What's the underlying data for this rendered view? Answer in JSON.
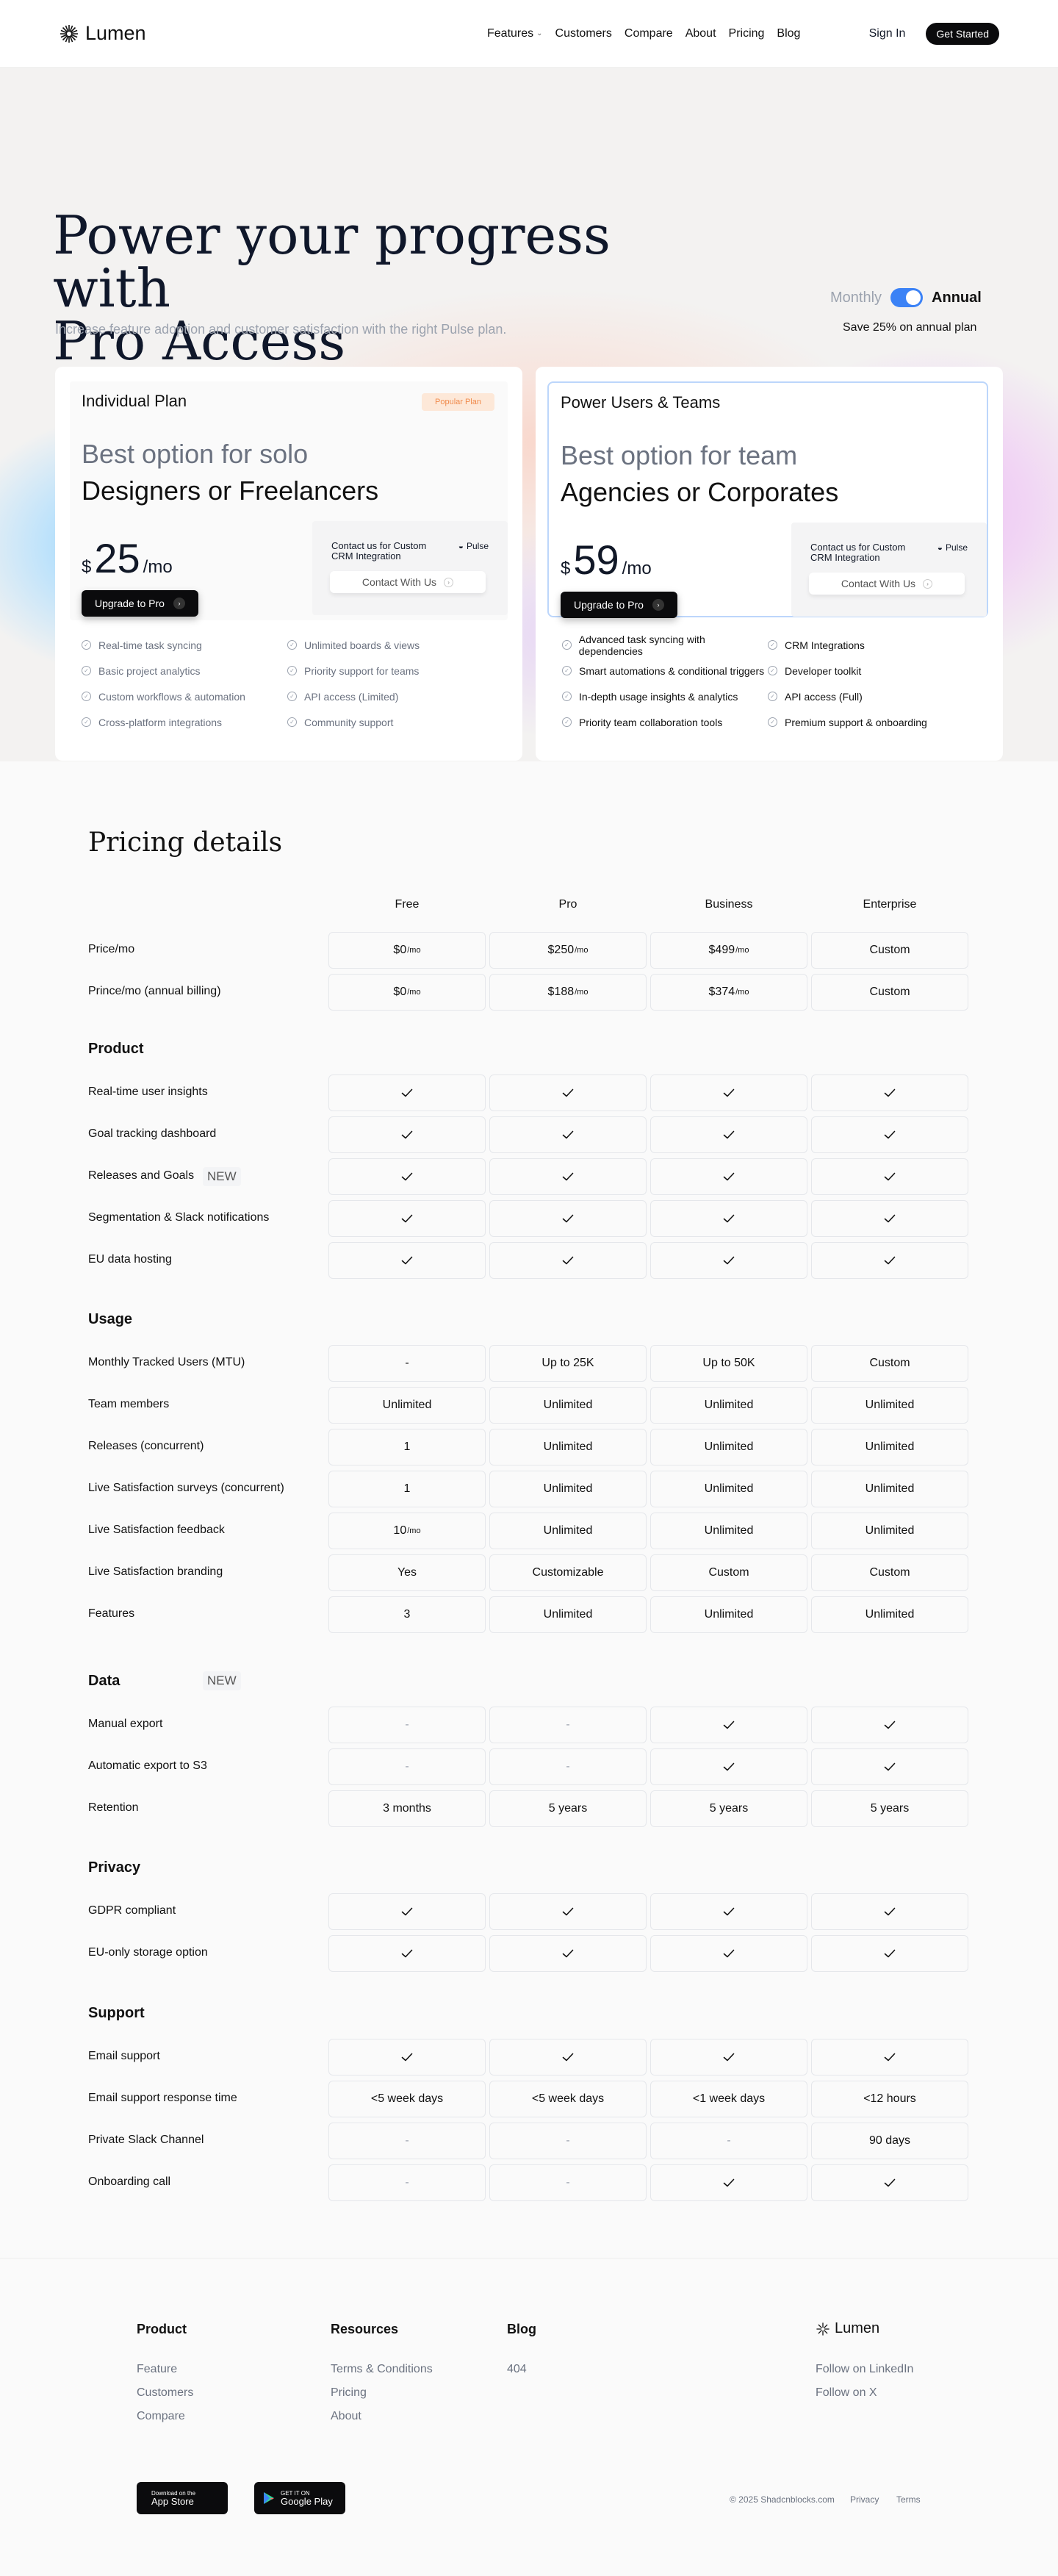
{
  "nav": {
    "logo": "Lumen",
    "links": [
      "Features",
      "Customers",
      "Compare",
      "About",
      "Pricing",
      "Blog"
    ],
    "sign_in": "Sign In",
    "get_started": "Get Started"
  },
  "hero": {
    "title_line1": "Power your progress with",
    "title_line2": "Pro Access",
    "subtitle": "Increase feature adoption and customer satisfaction with the right Pulse plan.",
    "billing_monthly": "Monthly",
    "billing_annual": "Annual",
    "billing_selected": "Annual",
    "save_note": "Save 25% on annual plan"
  },
  "plans": [
    {
      "name": "Individual Plan",
      "badge": "Popular Plan",
      "best": "Best option for solo",
      "who": "Designers or Freelancers",
      "currency": "$",
      "price": "25",
      "period": "/mo",
      "cta": "Upgrade to Pro",
      "contact_text": "Contact us for Custom CRM Integration",
      "contact_brand": "Pulse",
      "contact_cta": "Contact With Us",
      "features": [
        "Real-time task syncing",
        "Unlimited boards & views",
        "Basic project analytics",
        "Priority support for teams",
        "Custom workflows & automation",
        "API access (Limited)",
        "Cross-platform integrations",
        "Community support"
      ]
    },
    {
      "name": "Power Users & Teams",
      "best": "Best option for team",
      "who": "Agencies or Corporates",
      "currency": "$",
      "price": "59",
      "period": "/mo",
      "cta": "Upgrade to Pro",
      "contact_text": "Contact us for Custom CRM Integration",
      "contact_brand": "Pulse",
      "contact_cta": "Contact With Us",
      "features": [
        "Advanced task syncing with dependencies",
        "CRM Integrations",
        "Smart automations & conditional triggers",
        "Developer toolkit",
        "In-depth usage insights & analytics",
        "API access (Full)",
        "Priority team collaboration tools",
        "Premium support & onboarding"
      ]
    }
  ],
  "details": {
    "title": "Pricing details",
    "columns": [
      "Free",
      "Pro",
      "Business",
      "Enterprise"
    ],
    "new_label": "NEW",
    "sections": [
      {
        "name": "",
        "rows": [
          {
            "label": "Price/mo",
            "values": [
              [
                "$0",
                "/mo"
              ],
              [
                "$250",
                "/mo"
              ],
              [
                "$499",
                "/mo"
              ],
              "Custom"
            ]
          },
          {
            "label": "Prince/mo (annual billing)",
            "values": [
              [
                "$0",
                "/mo"
              ],
              [
                "$188",
                "/mo"
              ],
              [
                "$374",
                "/mo"
              ],
              "Custom"
            ]
          }
        ]
      },
      {
        "name": "Product",
        "rows": [
          {
            "label": "Real-time user insights",
            "values": [
              "✓",
              "✓",
              "✓",
              "✓"
            ]
          },
          {
            "label": "Goal tracking dashboard",
            "values": [
              "✓",
              "✓",
              "✓",
              "✓"
            ]
          },
          {
            "label": "Releases and Goals",
            "new": true,
            "values": [
              "✓",
              "✓",
              "✓",
              "✓"
            ]
          },
          {
            "label": "Segmentation & Slack notifications",
            "values": [
              "✓",
              "✓",
              "✓",
              "✓"
            ]
          },
          {
            "label": "EU data hosting",
            "values": [
              "✓",
              "✓",
              "✓",
              "✓"
            ]
          }
        ]
      },
      {
        "name": "Usage",
        "rows": [
          {
            "label": "Monthly Tracked Users (MTU)",
            "values": [
              "-",
              "Up to 25K",
              "Up to 50K",
              "Custom"
            ]
          },
          {
            "label": "Team members",
            "values": [
              "Unlimited",
              "Unlimited",
              "Unlimited",
              "Unlimited"
            ]
          },
          {
            "label": "Releases (concurrent)",
            "values": [
              "1",
              "Unlimited",
              "Unlimited",
              "Unlimited"
            ]
          },
          {
            "label": "Live Satisfaction surveys (concurrent)",
            "values": [
              "1",
              "Unlimited",
              "Unlimited",
              "Unlimited"
            ]
          },
          {
            "label": "Live Satisfaction feedback",
            "values": [
              [
                "10",
                "/mo"
              ],
              "Unlimited",
              "Unlimited",
              "Unlimited"
            ]
          },
          {
            "label": "Live Satisfaction branding",
            "values": [
              "Yes",
              "Customizable",
              "Custom",
              "Custom"
            ]
          },
          {
            "label": "Features",
            "values": [
              "3",
              "Unlimited",
              "Unlimited",
              "Unlimited"
            ]
          }
        ]
      },
      {
        "name": "Data",
        "new": true,
        "rows": [
          {
            "label": "Manual export",
            "values": [
              "-",
              "-",
              "✓",
              "✓"
            ]
          },
          {
            "label": "Automatic export to S3",
            "values": [
              "-",
              "-",
              "✓",
              "✓"
            ]
          },
          {
            "label": "Retention",
            "values": [
              "3 months",
              "5 years",
              "5 years",
              "5 years"
            ]
          }
        ]
      },
      {
        "name": "Privacy",
        "rows": [
          {
            "label": "GDPR compliant",
            "values": [
              "✓",
              "✓",
              "✓",
              "✓"
            ]
          },
          {
            "label": "EU-only storage option",
            "values": [
              "✓",
              "✓",
              "✓",
              "✓"
            ]
          }
        ]
      },
      {
        "name": "Support",
        "rows": [
          {
            "label": "Email support",
            "values": [
              "✓",
              "✓",
              "✓",
              "✓"
            ]
          },
          {
            "label": "Email support response time",
            "values": [
              "<5 week days",
              "<5 week days",
              "<1 week days",
              "<12 hours"
            ]
          },
          {
            "label": "Private Slack Channel",
            "values": [
              "-",
              "-",
              "-",
              "90 days"
            ]
          },
          {
            "label": "Onboarding call",
            "values": [
              "-",
              "-",
              "✓",
              "✓"
            ]
          }
        ]
      }
    ]
  },
  "footer": {
    "product_title": "Product",
    "product_links": [
      "Feature",
      "Customers",
      "Compare"
    ],
    "resources_title": "Resources",
    "resources_links": [
      "Terms & Conditions",
      "Pricing",
      "About"
    ],
    "blog_title": "Blog",
    "blog_links": [
      "404"
    ],
    "logo": "Lumen",
    "social": [
      "Follow on LinkedIn",
      "Follow on X"
    ],
    "app_store_small": "Download on the",
    "app_store": "App Store",
    "google_small": "GET IT ON",
    "google": "Google Play",
    "copyright": "© 2025 Shadcnblocks.com",
    "privacy": "Privacy",
    "terms": "Terms"
  }
}
